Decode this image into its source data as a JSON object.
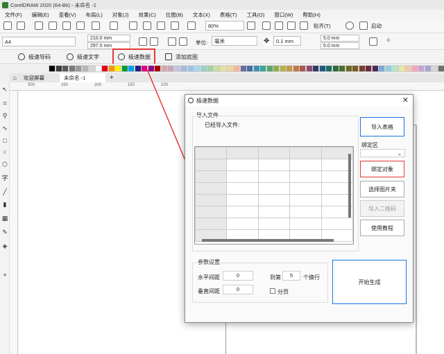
{
  "app": {
    "title": "CorelDRAW 2020 (64-Bit) - 未命名 -1"
  },
  "menu": [
    "文件(F)",
    "编辑(E)",
    "查看(V)",
    "布局(L)",
    "对象(J)",
    "效果(C)",
    "位图(B)",
    "文本(X)",
    "表格(T)",
    "工具(O)",
    "窗口(W)",
    "帮助(H)"
  ],
  "toolbar": {
    "zoom": "80%",
    "snap_label": "贴齐(T)",
    "launch_label": "启动"
  },
  "propbar": {
    "page_size": "A4",
    "width": "210.0 mm",
    "height": "297.0 mm",
    "unit_label": "单位:",
    "unit": "毫米",
    "nudge": "0.1 mm",
    "dup_x": "5.0 mm",
    "dup_y": "5.0 mm"
  },
  "plugins": {
    "barcode": "极速导码",
    "text": "极速文字",
    "data": "极速数据",
    "bottom": "添加底图"
  },
  "tabs": {
    "welcome": "欢迎屏幕",
    "doc": "未命名 -1",
    "add": "+"
  },
  "ruler": {
    "h": [
      "300",
      "250",
      "200",
      "150",
      "100",
      "50",
      "0",
      "50",
      "100",
      "150",
      "200",
      "250",
      "300"
    ],
    "v": [
      "200",
      "250",
      "200",
      "150",
      "100"
    ]
  },
  "palette": [
    "#000000",
    "#3b3b3b",
    "#595959",
    "#7a7a7a",
    "#999999",
    "#b7b7b7",
    "#d6d6d6",
    "#ffffff",
    "#e60012",
    "#f39800",
    "#fff100",
    "#009944",
    "#00a0e9",
    "#1d2088",
    "#e4007f",
    "#920783",
    "#a40000",
    "#d7a7a7",
    "#c9a6b7",
    "#c3c3e0",
    "#a6b9dc",
    "#9cc3e6",
    "#a3d6f5",
    "#99d2c5",
    "#a7d1a0",
    "#c8dd9f",
    "#e5e39d",
    "#f3d49c",
    "#f3b49c",
    "#6b6b9c",
    "#4a6fa5",
    "#3d8fb3",
    "#3aa39b",
    "#5aa469",
    "#8cae4f",
    "#b5b04a",
    "#c29a4a",
    "#c07a46",
    "#a8584a",
    "#8e4a6c",
    "#2f3a6b",
    "#1f5a7a",
    "#1a6e66",
    "#2b6e3f",
    "#4e6e2a",
    "#6e6a28",
    "#7a5a28",
    "#7a3e28",
    "#6b2a3a",
    "#4a2a5a",
    "#7aa7d6",
    "#8fd1e0",
    "#b6e3c6",
    "#e7e7a8",
    "#f5c7a6",
    "#f2a6b8",
    "#c7a6d6",
    "#a6a6d6",
    "#d6d6d6",
    "#6f6f6f"
  ],
  "dialog": {
    "title": "极速数据",
    "import_group": "导入文件",
    "imported_label": "已经导入文件:",
    "btn_import_table": "导入表格",
    "bind_area_label": "绑定区",
    "btn_bind_object": "绑定对象",
    "btn_select_folder": "选择图片夹",
    "btn_import_qr": "导入二维码",
    "btn_tutorial": "使用教程",
    "param_group": "参数设置",
    "h_spacing_label": "水平间距",
    "h_spacing_value": "0",
    "v_spacing_label": "垂直间距",
    "v_spacing_value": "0",
    "wrap_prefix": "到第",
    "wrap_value": "5",
    "wrap_suffix": "个换行",
    "paging_label": "分页",
    "btn_generate": "开始生成",
    "close_glyph": "✕"
  }
}
